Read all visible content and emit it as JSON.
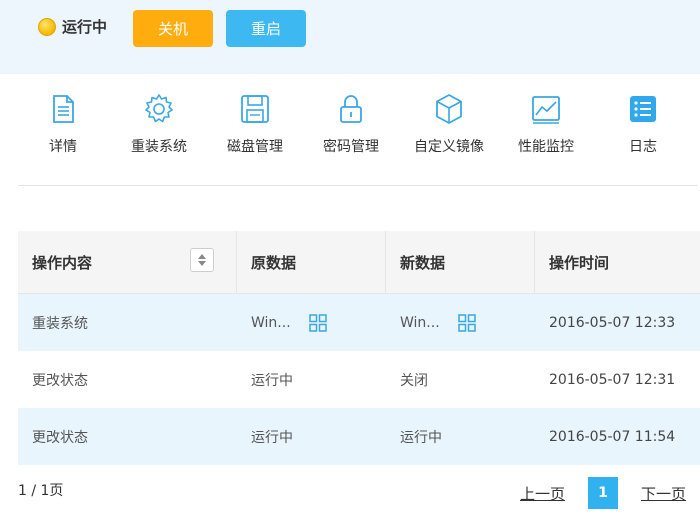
{
  "header": {
    "status_label": "运行中",
    "status_color": "#f5b800",
    "buttons": {
      "shutdown": "关机",
      "restart": "重启"
    }
  },
  "toolbar": {
    "items": [
      {
        "label": "详情",
        "icon": "document-icon"
      },
      {
        "label": "重装系统",
        "icon": "gear-icon"
      },
      {
        "label": "磁盘管理",
        "icon": "floppy-disk-icon"
      },
      {
        "label": "密码管理",
        "icon": "lock-icon"
      },
      {
        "label": "自定义镜像",
        "icon": "cube-icon"
      },
      {
        "label": "性能监控",
        "icon": "chart-icon"
      },
      {
        "label": "日志",
        "icon": "list-icon",
        "active": true
      }
    ]
  },
  "table": {
    "columns": [
      "操作内容",
      "原数据",
      "新数据",
      "操作时间"
    ],
    "rows": [
      {
        "action": "重装系统",
        "old": "Win...",
        "new": "Win...",
        "time": "2016-05-07 12:33"
      },
      {
        "action": "更改状态",
        "old": "运行中",
        "new": "关闭",
        "time": "2016-05-07 12:31"
      },
      {
        "action": "更改状态",
        "old": "运行中",
        "new": "运行中",
        "time": "2016-05-07 11:54"
      }
    ]
  },
  "pagination": {
    "info": "1 / 1页",
    "prev": "上一页",
    "current": "1",
    "next": "下一页"
  },
  "colors": {
    "accent": "#2fb2ef",
    "shutdown": "#ffad0e",
    "restart": "#3eb8f1",
    "header_bg": "#eef6fd",
    "row_alt": "#e9f5fd"
  }
}
